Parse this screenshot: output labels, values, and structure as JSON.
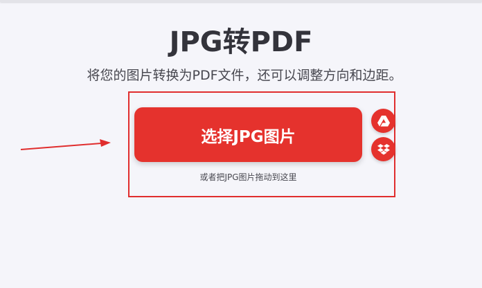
{
  "page": {
    "title": "JPG转PDF",
    "subtitle": "将您的图片转换为PDF文件，还可以调整方向和边距。"
  },
  "upload": {
    "select_button_label": "选择JPG图片",
    "drop_hint": "或者把JPG图片拖动到这里",
    "cloud_buttons": [
      {
        "icon": "google-drive-icon"
      },
      {
        "icon": "dropbox-icon"
      }
    ]
  },
  "annotation": {
    "arrow_color": "#e02d2d",
    "highlight_color": "#e02d2d"
  },
  "colors": {
    "brand": "#e5322d",
    "background": "#f5f5fa",
    "text": "#33333b"
  }
}
